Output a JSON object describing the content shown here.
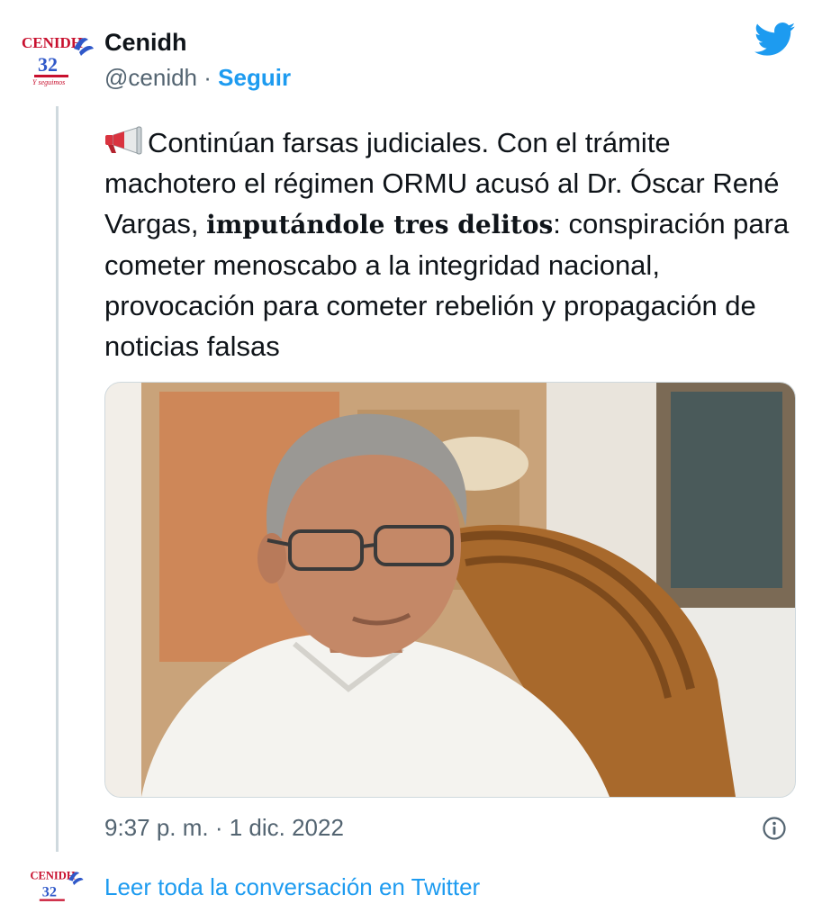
{
  "author": {
    "display_name": "Cenidh",
    "handle": "@cenidh",
    "separator": "·",
    "follow_label": "Seguir",
    "avatar_logo_text": "CENIDH",
    "avatar_badge_number": "32",
    "avatar_tagline": "Y seguimos"
  },
  "tweet": {
    "text_before_bold": "Continúan farsas judiciales. Con el trámite machotero el régimen ORMU acusó al Dr. Óscar René Vargas, ",
    "text_bold": "imputándole tres delitos",
    "text_after_bold": ": conspiración para cometer menoscabo a la integridad nacional, provocación para cometer rebelión y propagación de noticias falsas",
    "emoji_icon": "megaphone-icon",
    "media_icon": "photo-elderly-man-glasses-white-shirt"
  },
  "meta": {
    "timestamp": "9:37 p. m. · 1 dic. 2022",
    "info_icon": "info-icon"
  },
  "footer": {
    "read_link": "Leer toda la conversación en Twitter"
  },
  "colors": {
    "accent": "#1d9bf0",
    "text_primary": "#0f1419",
    "text_secondary": "#536471",
    "line": "#cfd9de",
    "logo_red": "#c8102e",
    "logo_blue": "#2f58c9"
  }
}
